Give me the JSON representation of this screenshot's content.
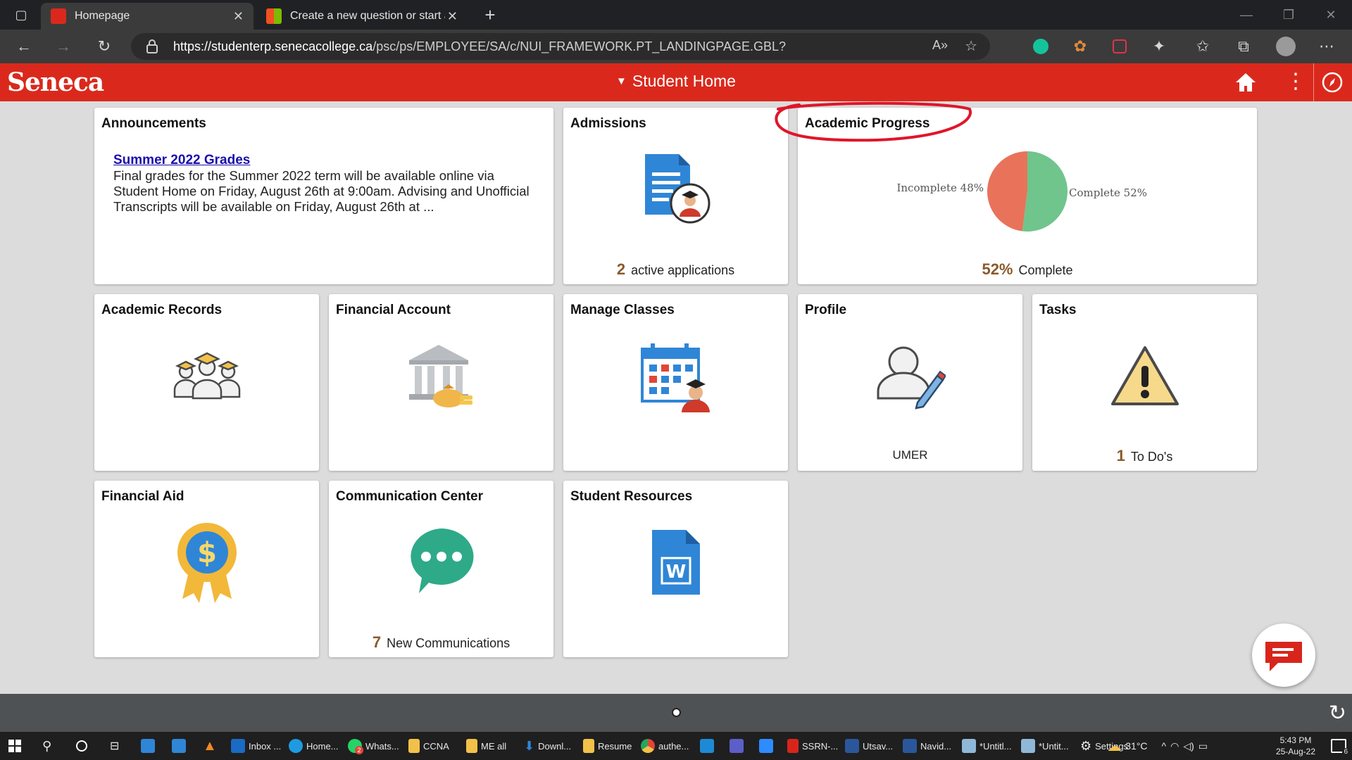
{
  "browser": {
    "tabs": [
      {
        "title": "Homepage",
        "active": true
      },
      {
        "title": "Create a new question or start a",
        "active": false
      }
    ],
    "url_host": "https://studenterp.senecacollege.ca",
    "url_path": "/psc/ps/EMPLOYEE/SA/c/NUI_FRAMEWORK.PT_LANDINGPAGE.GBL?"
  },
  "app": {
    "logo": "Seneca",
    "page_title": "Student Home",
    "brand_color": "#da291c"
  },
  "tiles": {
    "announcements": {
      "title": "Announcements",
      "link": "Summer 2022 Grades",
      "text": "Final grades for the Summer 2022 term will be available online via Student Home on Friday, August 26th at 9:00am. Advising and Unofficial Transcripts will be available on Friday, August 26th at ..."
    },
    "admissions": {
      "title": "Admissions",
      "count": "2",
      "label": "active applications"
    },
    "academic_progress": {
      "title": "Academic Progress",
      "percent": "52%",
      "label": "Complete",
      "chart_labels": {
        "incomplete": "Incomplete 48%",
        "complete": "Complete 52%"
      }
    },
    "academic_records": {
      "title": "Academic Records"
    },
    "financial_account": {
      "title": "Financial Account"
    },
    "manage_classes": {
      "title": "Manage Classes"
    },
    "profile": {
      "title": "Profile",
      "name": "UMER"
    },
    "tasks": {
      "title": "Tasks",
      "count": "1",
      "label": "To Do's"
    },
    "financial_aid": {
      "title": "Financial Aid"
    },
    "communication_center": {
      "title": "Communication Center",
      "count": "7",
      "label": "New Communications"
    },
    "student_resources": {
      "title": "Student Resources"
    }
  },
  "chart_data": {
    "type": "pie",
    "categories": [
      "Incomplete",
      "Complete"
    ],
    "values": [
      48,
      52
    ],
    "colors": [
      "#e8735a",
      "#6fc58c"
    ]
  },
  "taskbar": {
    "apps": [
      "Inbox ...",
      "Home...",
      "Whats...",
      "CCNA",
      "ME all",
      "Downl...",
      "Resume",
      "authe...",
      "SSRN-...",
      "Utsav...",
      "Navid...",
      "*Untitl...",
      "*Untit...",
      "Settings"
    ],
    "weather": "31°C",
    "time": "5:43 PM",
    "date": "25-Aug-22",
    "notif_count": "6",
    "whatsapp_badge": "2"
  }
}
